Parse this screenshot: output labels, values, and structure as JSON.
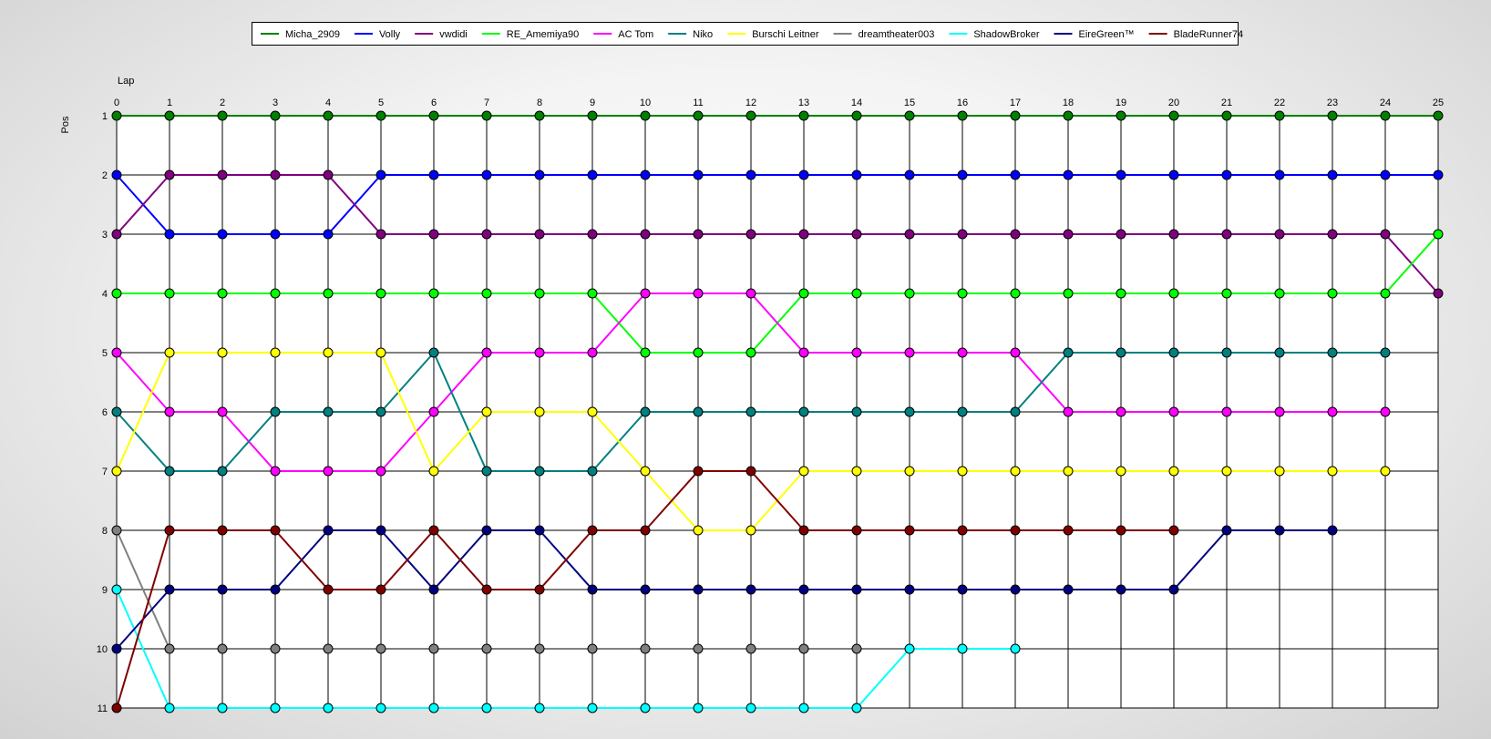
{
  "chart_data": {
    "type": "line",
    "xlabel": "Lap",
    "ylabel": "Pos",
    "x": [
      0,
      1,
      2,
      3,
      4,
      5,
      6,
      7,
      8,
      9,
      10,
      11,
      12,
      13,
      14,
      15,
      16,
      17,
      18,
      19,
      20,
      21,
      22,
      23,
      24,
      25
    ],
    "y_ticks": [
      1,
      2,
      3,
      4,
      5,
      6,
      7,
      8,
      9,
      10,
      11
    ],
    "xlim": [
      0,
      25
    ],
    "ylim": [
      1,
      11
    ],
    "y_inverted": true,
    "grid": true,
    "legend_position": "top-center",
    "series": [
      {
        "name": "Micha_2909",
        "color": "#008000",
        "values": [
          1,
          1,
          1,
          1,
          1,
          1,
          1,
          1,
          1,
          1,
          1,
          1,
          1,
          1,
          1,
          1,
          1,
          1,
          1,
          1,
          1,
          1,
          1,
          1,
          1,
          1
        ]
      },
      {
        "name": "Volly",
        "color": "#0000ff",
        "values": [
          2,
          3,
          3,
          3,
          3,
          2,
          2,
          2,
          2,
          2,
          2,
          2,
          2,
          2,
          2,
          2,
          2,
          2,
          2,
          2,
          2,
          2,
          2,
          2,
          2,
          2
        ]
      },
      {
        "name": "vwdidi",
        "color": "#800080",
        "values": [
          3,
          2,
          2,
          2,
          2,
          3,
          3,
          3,
          3,
          3,
          3,
          3,
          3,
          3,
          3,
          3,
          3,
          3,
          3,
          3,
          3,
          3,
          3,
          3,
          3,
          4
        ]
      },
      {
        "name": "RE_Amemiya90",
        "color": "#00ff00",
        "values": [
          4,
          4,
          4,
          4,
          4,
          4,
          4,
          4,
          4,
          4,
          5,
          5,
          5,
          4,
          4,
          4,
          4,
          4,
          4,
          4,
          4,
          4,
          4,
          4,
          4,
          3
        ]
      },
      {
        "name": "AC Tom",
        "color": "#ff00ff",
        "values": [
          5,
          6,
          6,
          7,
          7,
          7,
          6,
          5,
          5,
          5,
          4,
          4,
          4,
          5,
          5,
          5,
          5,
          5,
          6,
          6,
          6,
          6,
          6,
          6,
          6
        ]
      },
      {
        "name": "Niko",
        "color": "#008080",
        "values": [
          6,
          7,
          7,
          6,
          6,
          6,
          5,
          7,
          7,
          7,
          6,
          6,
          6,
          6,
          6,
          6,
          6,
          6,
          5,
          5,
          5,
          5,
          5,
          5,
          5
        ]
      },
      {
        "name": "Burschi Leitner",
        "color": "#ffff00",
        "values": [
          7,
          5,
          5,
          5,
          5,
          5,
          7,
          6,
          6,
          6,
          7,
          8,
          8,
          7,
          7,
          7,
          7,
          7,
          7,
          7,
          7,
          7,
          7,
          7,
          7
        ]
      },
      {
        "name": "dreamtheater003",
        "color": "#808080",
        "values": [
          8,
          10,
          10,
          10,
          10,
          10,
          10,
          10,
          10,
          10,
          10,
          10,
          10,
          10,
          10
        ]
      },
      {
        "name": "ShadowBroker",
        "color": "#00ffff",
        "values": [
          9,
          11,
          11,
          11,
          11,
          11,
          11,
          11,
          11,
          11,
          11,
          11,
          11,
          11,
          11,
          10,
          10,
          10
        ]
      },
      {
        "name": "EireGreen™",
        "color": "#000080",
        "values": [
          10,
          9,
          9,
          9,
          8,
          8,
          9,
          8,
          8,
          9,
          9,
          9,
          9,
          9,
          9,
          9,
          9,
          9,
          9,
          9,
          9,
          8,
          8,
          8
        ]
      },
      {
        "name": "BladeRunner74",
        "color": "#800000",
        "values": [
          11,
          8,
          8,
          8,
          9,
          9,
          8,
          9,
          9,
          8,
          8,
          7,
          7,
          8,
          8,
          8,
          8,
          8,
          8,
          8,
          8
        ]
      }
    ]
  }
}
